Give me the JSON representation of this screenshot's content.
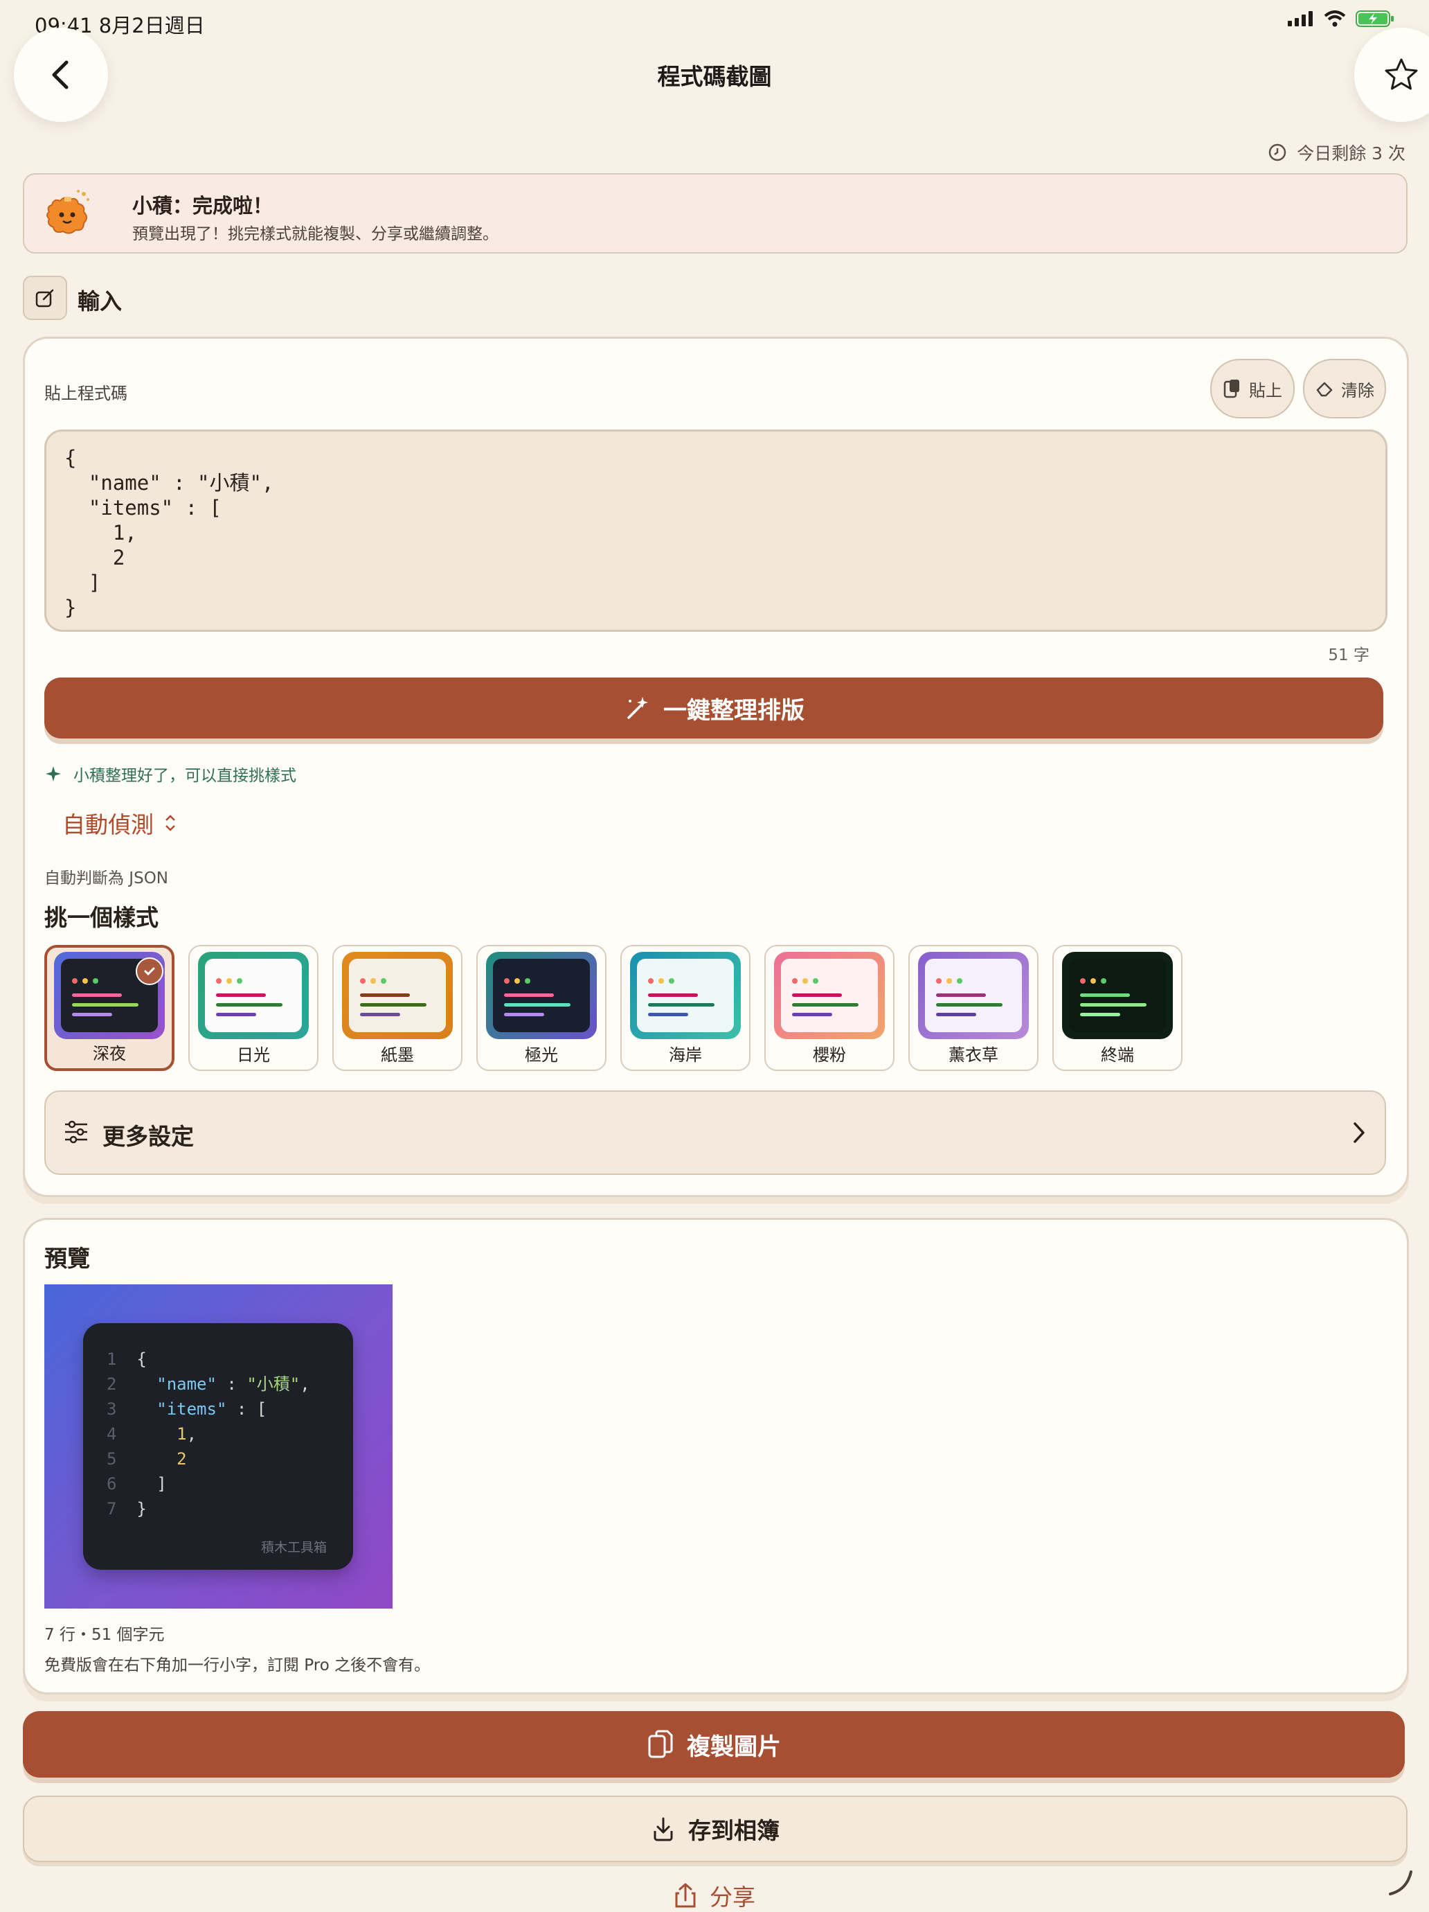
{
  "status_bar": {
    "time": "09:41  8月2日週日"
  },
  "nav": {
    "title": "程式碼截圖"
  },
  "usage": {
    "remaining": "今日剩餘 3 次"
  },
  "banner": {
    "title": "小積：完成啦！",
    "subtitle": "預覽出現了！挑完樣式就能複製、分享或繼續調整。"
  },
  "input_section": {
    "label": "輸入",
    "paste_label": "貼上程式碼",
    "paste_button": "貼上",
    "clear_button": "清除",
    "code": "{\n  \"name\" : \"小積\",\n  \"items\" : [\n    1,\n    2\n  ]\n}",
    "char_count": "51 字",
    "format_button": "一鍵整理排版",
    "hint": "小積整理好了，可以直接挑樣式",
    "language_select": "自動偵測",
    "language_detected": "自動判斷為 JSON",
    "style_title": "挑一個樣式",
    "themes": [
      {
        "name": "深夜",
        "selected": true
      },
      {
        "name": "日光",
        "selected": false
      },
      {
        "name": "紙墨",
        "selected": false
      },
      {
        "name": "極光",
        "selected": false
      },
      {
        "name": "海岸",
        "selected": false
      },
      {
        "name": "櫻粉",
        "selected": false
      },
      {
        "name": "薰衣草",
        "selected": false
      },
      {
        "name": "終端",
        "selected": false
      }
    ],
    "more_settings": "更多設定"
  },
  "preview": {
    "title": "預覽",
    "line_numbers": [
      "1",
      "2",
      "3",
      "4",
      "5",
      "6",
      "7"
    ],
    "watermark": "積木工具箱",
    "meta": "7 行・51 個字元",
    "note": "免費版會在右下角加一行小字，訂閱 Pro 之後不會有。"
  },
  "actions": {
    "copy": "複製圖片",
    "save": "存到相簿",
    "share": "分享"
  },
  "colors": {
    "accent": "#a64f33",
    "background": "#f7f1e7",
    "card": "#fffdf7"
  }
}
